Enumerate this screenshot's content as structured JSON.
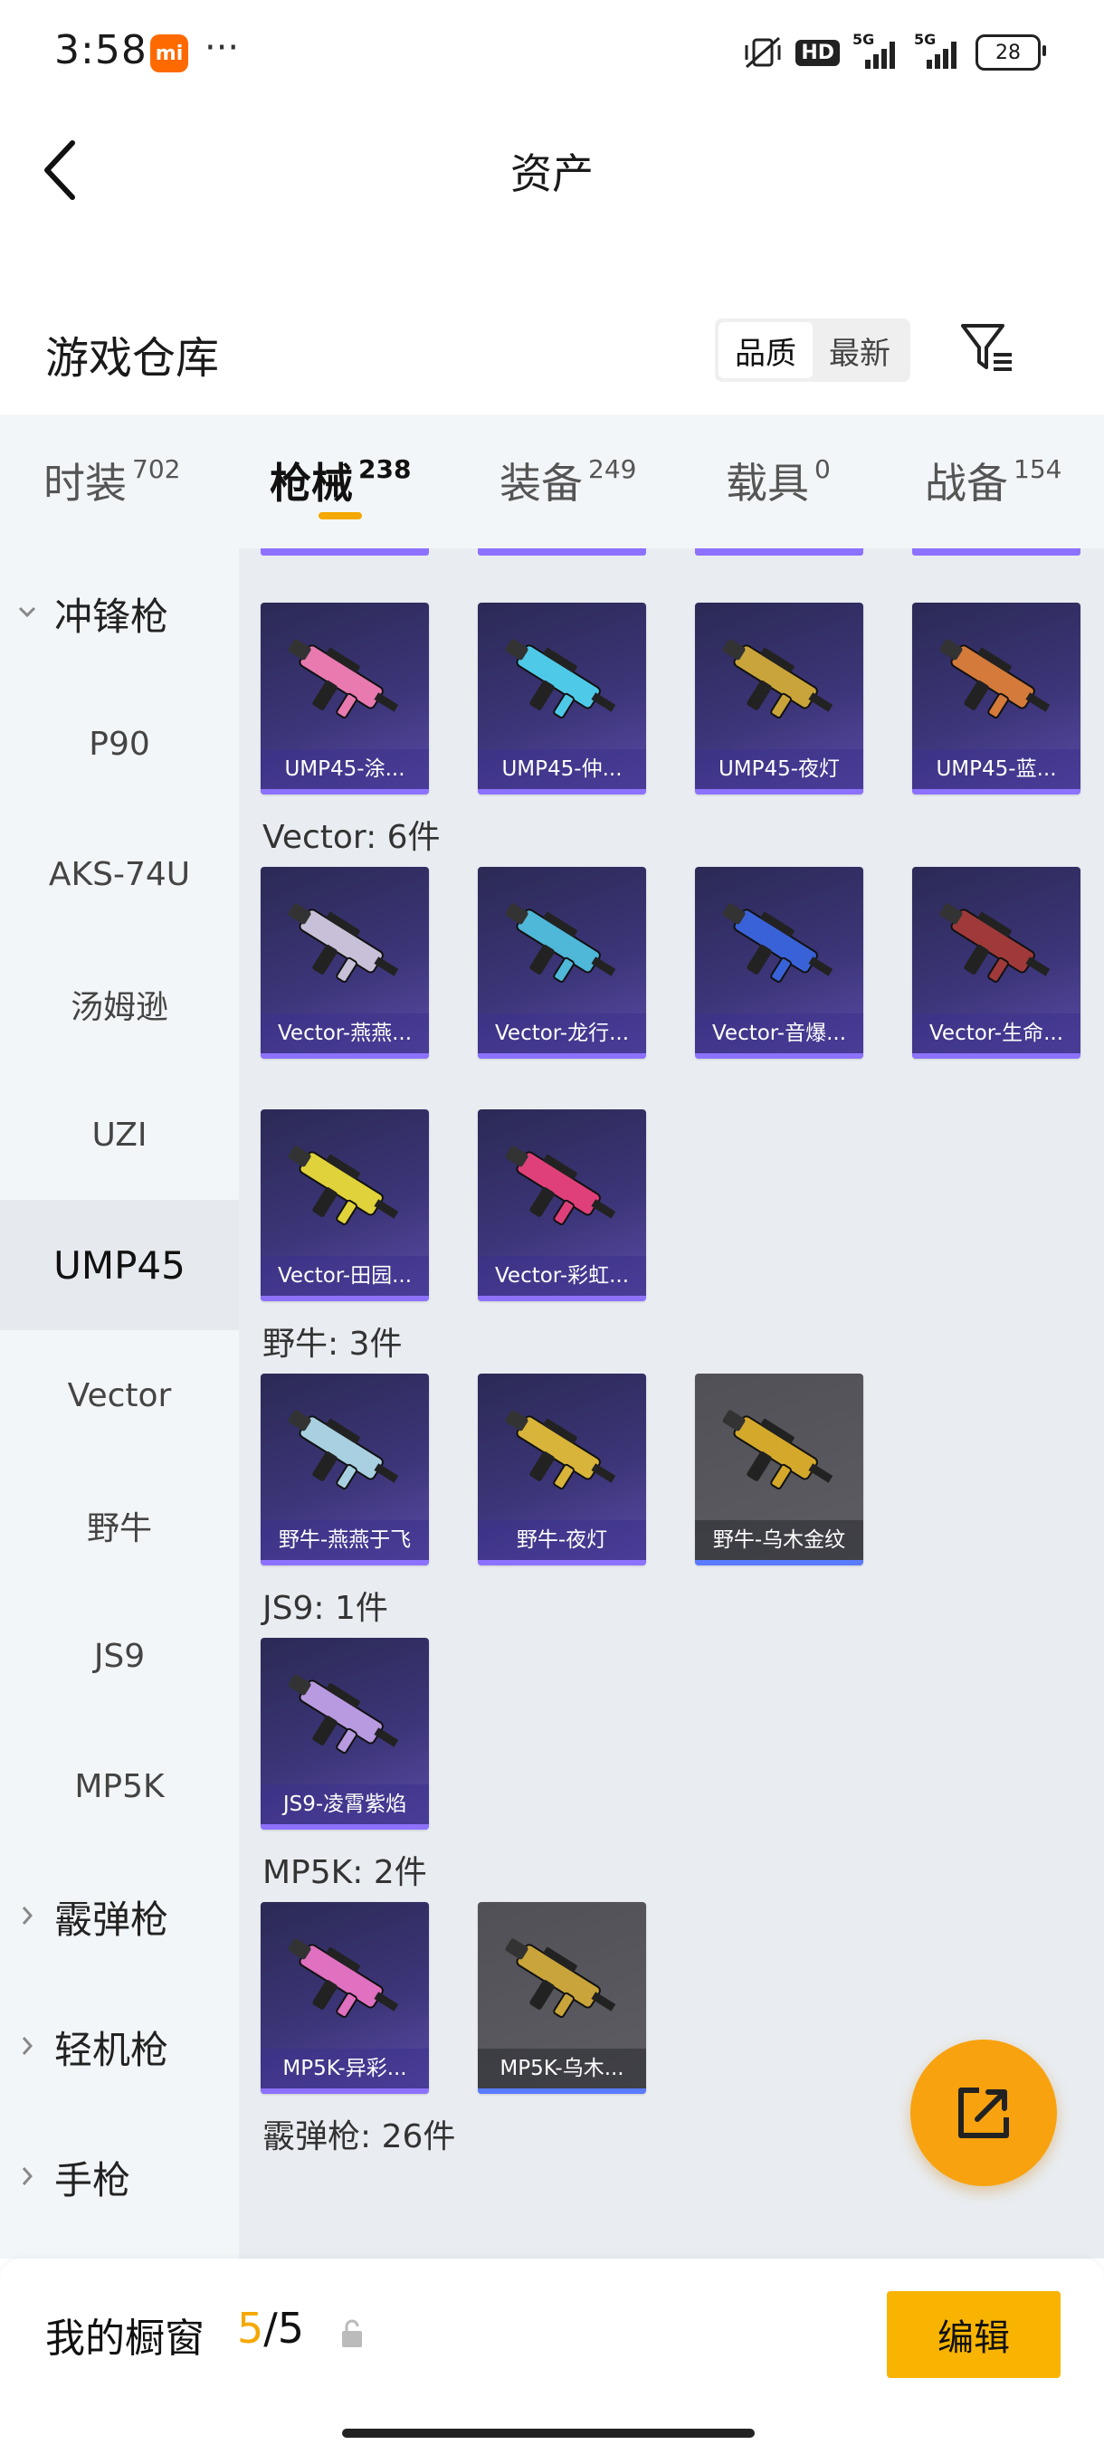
{
  "status_bar": {
    "time": "3:58",
    "mi_badge": "mi",
    "more": "···",
    "hd": "HD",
    "sig1": "5G",
    "sig2": "5G",
    "battery": "28"
  },
  "nav": {
    "title": "资产"
  },
  "header": {
    "title": "游戏仓库",
    "sort_options": [
      "品质",
      "最新"
    ],
    "active_sort": "品质"
  },
  "tabs": [
    {
      "label": "时装",
      "count": "702"
    },
    {
      "label": "枪械",
      "count": "238"
    },
    {
      "label": "装备",
      "count": "249"
    },
    {
      "label": "载具",
      "count": "0"
    },
    {
      "label": "战备",
      "count": "154"
    }
  ],
  "active_tab": "枪械",
  "sidebar": {
    "items": [
      {
        "label": "冲锋枪",
        "type": "category",
        "expanded": true
      },
      {
        "label": "P90",
        "type": "sub"
      },
      {
        "label": "AKS-74U",
        "type": "sub"
      },
      {
        "label": "汤姆逊",
        "type": "sub"
      },
      {
        "label": "UZI",
        "type": "sub"
      },
      {
        "label": "UMP45",
        "type": "sub",
        "active": true
      },
      {
        "label": "Vector",
        "type": "sub"
      },
      {
        "label": "野牛",
        "type": "sub"
      },
      {
        "label": "JS9",
        "type": "sub"
      },
      {
        "label": "MP5K",
        "type": "sub"
      },
      {
        "label": "霰弹枪",
        "type": "category",
        "expanded": false
      },
      {
        "label": "轻机枪",
        "type": "category",
        "expanded": false
      },
      {
        "label": "手枪",
        "type": "category",
        "expanded": false
      }
    ]
  },
  "content": {
    "groups": [
      {
        "label": "",
        "items": [
          {
            "name": "UMP45-涂...",
            "color": "#e87ab0"
          },
          {
            "name": "UMP45-仲...",
            "color": "#4fc9e8"
          },
          {
            "name": "UMP45-夜灯",
            "color": "#c9a43a"
          },
          {
            "name": "UMP45-蓝...",
            "color": "#d47a3a"
          }
        ]
      },
      {
        "label": "Vector: 6件",
        "items": [
          {
            "name": "Vector-燕燕...",
            "color": "#c8c0d8"
          },
          {
            "name": "Vector-龙行...",
            "color": "#4fb7d8"
          },
          {
            "name": "Vector-音爆...",
            "color": "#3a62d8"
          },
          {
            "name": "Vector-生命...",
            "color": "#a03a3a"
          },
          {
            "name": "Vector-田园...",
            "color": "#e0d23a"
          },
          {
            "name": "Vector-彩虹...",
            "color": "#e0407a"
          }
        ]
      },
      {
        "label": "野牛: 3件",
        "items": [
          {
            "name": "野牛-燕燕于飞",
            "color": "#a8d0e0"
          },
          {
            "name": "野牛-夜灯",
            "color": "#d8b43a"
          },
          {
            "name": "野牛-乌木金纹",
            "color": "#d4a82a",
            "gray": true
          }
        ]
      },
      {
        "label": "JS9: 1件",
        "items": [
          {
            "name": "JS9-凌霄紫焰",
            "color": "#b89ae0"
          }
        ]
      },
      {
        "label": "MP5K: 2件",
        "items": [
          {
            "name": "MP5K-异彩...",
            "color": "#e070c0"
          },
          {
            "name": "MP5K-乌木...",
            "color": "#c9a43a",
            "gray": true
          }
        ]
      },
      {
        "label": "霰弹枪: 26件",
        "items": []
      }
    ]
  },
  "bottom_bar": {
    "label": "我的橱窗",
    "current": "5",
    "separator": "/",
    "total": "5",
    "edit_label": "编辑"
  },
  "colors": {
    "accent": "#f5a800",
    "card_bg": "#3c3578",
    "card_bar": "#8d72ff",
    "fab": "#f8a20f"
  },
  "icons": [
    "back-arrow-icon",
    "filter-icon",
    "chevron-down-icon",
    "chevron-right-icon",
    "share-icon",
    "lock-icon"
  ]
}
